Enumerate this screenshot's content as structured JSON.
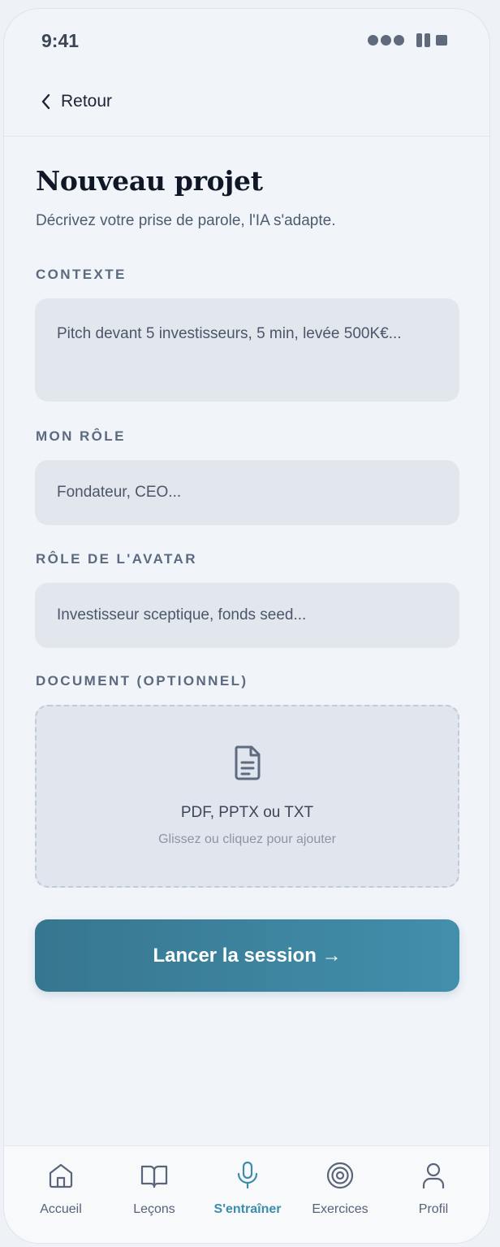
{
  "status_bar": {
    "time": "9:41"
  },
  "header": {
    "back_label": "Retour"
  },
  "page": {
    "title": "Nouveau projet",
    "subtitle": "Décrivez votre prise de parole, l'IA s'adapte."
  },
  "form": {
    "context": {
      "label": "CONTEXTE",
      "placeholder": "Pitch devant 5 investisseurs, 5 min, levée 500K€..."
    },
    "my_role": {
      "label": "MON RÔLE",
      "placeholder": "Fondateur, CEO..."
    },
    "avatar_role": {
      "label": "RÔLE DE L'AVATAR",
      "placeholder": "Investisseur sceptique, fonds seed..."
    },
    "document": {
      "label": "DOCUMENT (OPTIONNEL)",
      "formats": "PDF, PPTX ou TXT",
      "hint": "Glissez ou cliquez pour ajouter",
      "icon": "document-icon"
    }
  },
  "cta": {
    "label": "Lancer la session →"
  },
  "tab_bar": {
    "active": "S'entraîner",
    "accent_color": "#3a8eac",
    "items": [
      {
        "label": "Accueil",
        "icon": "home-icon"
      },
      {
        "label": "Leçons",
        "icon": "book-icon"
      },
      {
        "label": "S'entraîner",
        "icon": "microphone-icon"
      },
      {
        "label": "Exercices",
        "icon": "target-icon"
      },
      {
        "label": "Profil",
        "icon": "user-icon"
      }
    ]
  }
}
